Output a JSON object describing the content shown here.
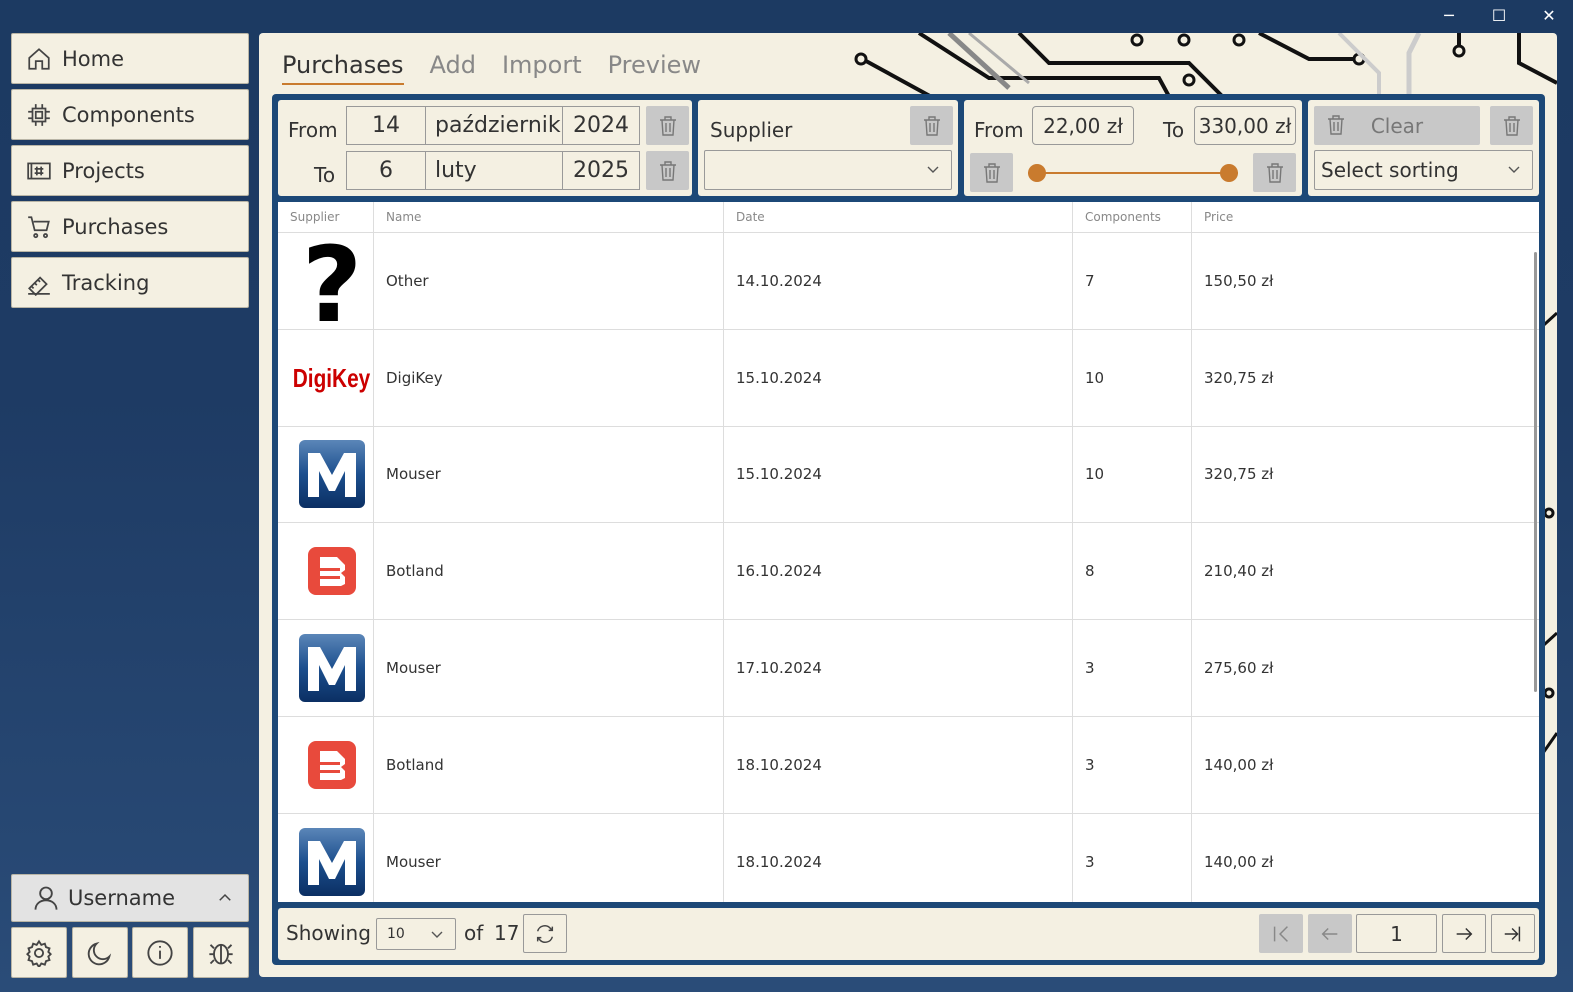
{
  "sidebar": {
    "items": [
      {
        "label": "Home",
        "icon": "home-icon"
      },
      {
        "label": "Components",
        "icon": "chip-icon"
      },
      {
        "label": "Projects",
        "icon": "board-icon"
      },
      {
        "label": "Purchases",
        "icon": "cart-icon"
      },
      {
        "label": "Tracking",
        "icon": "tracking-icon"
      }
    ],
    "user": {
      "label": "Username"
    }
  },
  "tabs": [
    {
      "label": "Purchases",
      "active": true
    },
    {
      "label": "Add"
    },
    {
      "label": "Import"
    },
    {
      "label": "Preview"
    }
  ],
  "filters": {
    "date": {
      "from_label": "From",
      "to_label": "To",
      "from": {
        "day": "14",
        "month": "październik",
        "year": "2024"
      },
      "to": {
        "day": "6",
        "month": "luty",
        "year": "2025"
      }
    },
    "supplier": {
      "label": "Supplier",
      "value": ""
    },
    "price": {
      "from_label": "From",
      "to_label": "To",
      "from": "22,00 zł",
      "to": "330,00 zł",
      "slider_min": 0,
      "slider_max": 1
    },
    "clear_label": "Clear",
    "sorting_placeholder": "Select sorting"
  },
  "table": {
    "headers": [
      "Supplier",
      "Name",
      "Date",
      "Components",
      "Price"
    ],
    "rows": [
      {
        "logo": "question-logo",
        "name": "Other",
        "date": "14.10.2024",
        "components": "7",
        "price": "150,50 zł"
      },
      {
        "logo": "digikey-logo",
        "logo_text": "DigiKey",
        "name": "DigiKey",
        "date": "15.10.2024",
        "components": "10",
        "price": "320,75 zł"
      },
      {
        "logo": "mouser-logo",
        "name": "Mouser",
        "date": "15.10.2024",
        "components": "10",
        "price": "320,75 zł"
      },
      {
        "logo": "botland-logo",
        "name": "Botland",
        "date": "16.10.2024",
        "components": "8",
        "price": "210,40 zł"
      },
      {
        "logo": "mouser-logo",
        "name": "Mouser",
        "date": "17.10.2024",
        "components": "3",
        "price": "275,60 zł"
      },
      {
        "logo": "botland-logo",
        "name": "Botland",
        "date": "18.10.2024",
        "components": "3",
        "price": "140,00 zł"
      },
      {
        "logo": "mouser-logo",
        "name": "Mouser",
        "date": "18.10.2024",
        "components": "3",
        "price": "140,00 zł"
      }
    ]
  },
  "pager": {
    "showing_label": "Showing",
    "page_size": "10",
    "of_label": "of",
    "total": "17",
    "page": "1"
  },
  "colors": {
    "accent": "#c97b2e",
    "panel": "#f4f0e2",
    "frame": "#1c4877",
    "digikey": "#cc0000",
    "botland": "#e84a3c",
    "mouser": "#0b3d78"
  }
}
